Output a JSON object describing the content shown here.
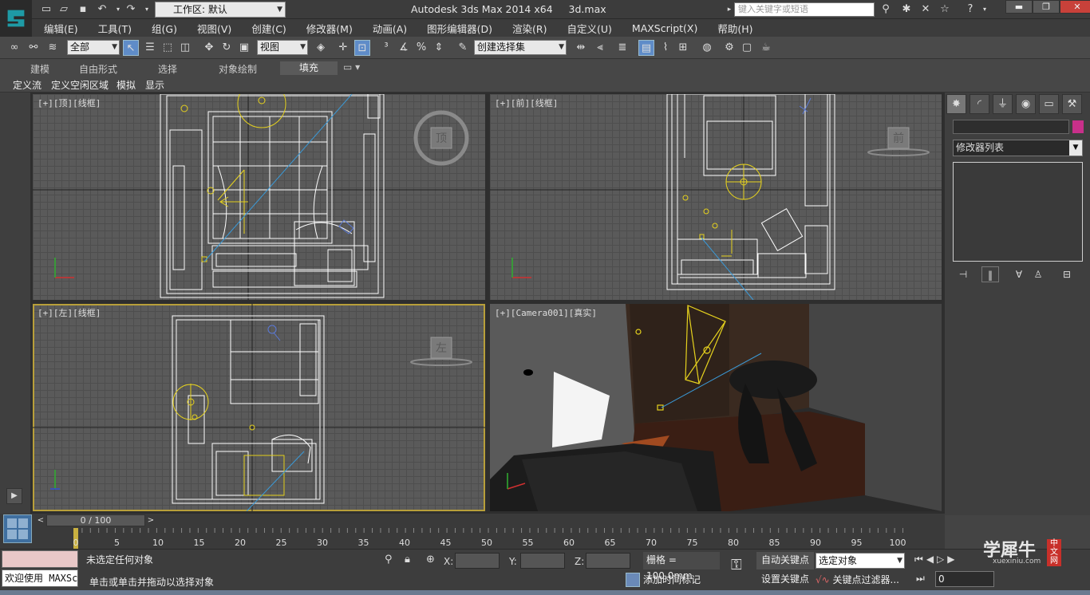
{
  "app": {
    "title": "Autodesk 3ds Max  2014 x64",
    "filename": "3d.max",
    "workspace_label": "工作区: 默认",
    "search_placeholder": "键入关键字或短语",
    "window_controls": [
      "minimize-icon",
      "restore-icon",
      "close-icon"
    ]
  },
  "menu": {
    "items": [
      "编辑(E)",
      "工具(T)",
      "组(G)",
      "视图(V)",
      "创建(C)",
      "修改器(M)",
      "动画(A)",
      "图形编辑器(D)",
      "渲染(R)",
      "自定义(U)",
      "MAXScript(X)",
      "帮助(H)"
    ]
  },
  "toolbar": {
    "filter_select": "全部",
    "refcoord_select": "视图",
    "named_selection": "创建选择集"
  },
  "ribbon": {
    "tabs": [
      "建模",
      "自由形式",
      "选择",
      "对象绘制",
      "填充"
    ],
    "active_tab": "填充",
    "subtabs": [
      "定义流",
      "定义空闲区域",
      "模拟",
      "显示"
    ]
  },
  "viewports": {
    "top": {
      "label": "[+][顶][线框]",
      "cube": "顶"
    },
    "front": {
      "label": "[+][前][线框]",
      "cube": "前"
    },
    "left": {
      "label": "[+][左][线框]",
      "cube": "左"
    },
    "camera": {
      "label": "[+][Camera001][真实]"
    }
  },
  "command_panel": {
    "tabs": [
      "create-icon",
      "modify-icon",
      "hierarchy-icon",
      "motion-icon",
      "display-icon",
      "utilities-icon"
    ],
    "modifier_list": "修改器列表",
    "object_color": "#c8308a"
  },
  "timeline": {
    "frame_indicator": "0 / 100",
    "ticks": [
      "0",
      "5",
      "10",
      "15",
      "20",
      "25",
      "30",
      "35",
      "40",
      "45",
      "50",
      "55",
      "60",
      "65",
      "70",
      "75",
      "80",
      "85",
      "90",
      "95",
      "100"
    ]
  },
  "status": {
    "maxscript_text": "欢迎使用  MAXSc",
    "selection_status": "未选定任何对象",
    "prompt": "单击或单击并拖动以选择对象",
    "x_label": "X:",
    "y_label": "Y:",
    "z_label": "Z:",
    "grid": "栅格 = 100.0mm",
    "add_time_tag": "添加时间标记",
    "auto_key": "自动关键点",
    "set_key": "设置关键点",
    "selected_dropdown": "选定对象",
    "key_filters": "关键点过滤器...",
    "current_frame": "0"
  },
  "watermark": {
    "text": "学犀牛",
    "badge": "中文网",
    "url": "xuexiniu.com"
  }
}
